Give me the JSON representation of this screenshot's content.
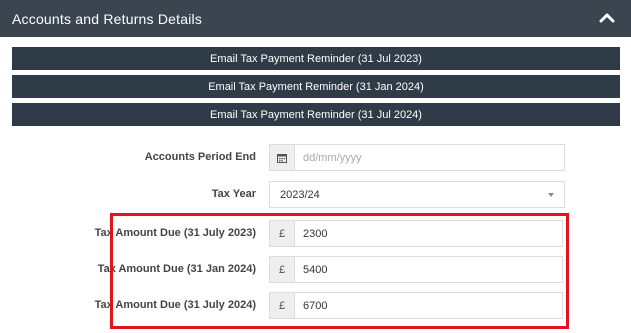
{
  "panel": {
    "title": "Accounts and Returns Details"
  },
  "reminders": [
    {
      "label": "Email Tax Payment Reminder (31 Jul 2023)"
    },
    {
      "label": "Email Tax Payment Reminder (31 Jan 2024)"
    },
    {
      "label": "Email Tax Payment Reminder (31 Jul 2024)"
    }
  ],
  "form": {
    "accounts_period_end": {
      "label": "Accounts Period End",
      "placeholder": "dd/mm/yyyy",
      "icon": "calendar-icon"
    },
    "tax_year": {
      "label": "Tax Year",
      "value": "2023/24"
    },
    "tax_due": [
      {
        "label": "Tax Amount Due (31 July 2023)",
        "currency": "£",
        "value": "2300"
      },
      {
        "label": "Tax Amount Due (31 Jan 2024)",
        "currency": "£",
        "value": "5400"
      },
      {
        "label": "Tax Amount Due (31 July 2024)",
        "currency": "£",
        "value": "6700"
      }
    ]
  },
  "colors": {
    "header": "#3a4550",
    "button": "#2f3b47",
    "highlight": "#e0141e"
  }
}
